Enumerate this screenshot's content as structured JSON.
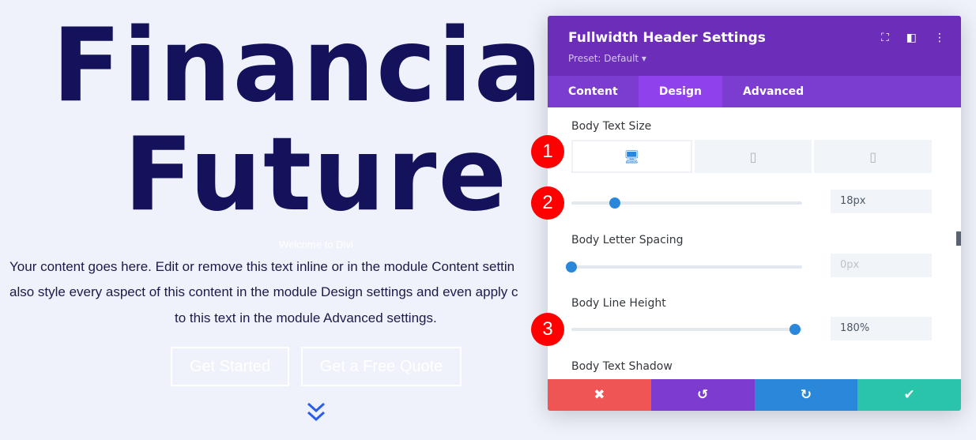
{
  "hero": {
    "title_line1": "Financial",
    "title_line2": "Future",
    "subtitle": "Welcome to Divi",
    "body_lines": [
      "Your content goes here. Edit or remove this text inline or in the module Content settin",
      "also style every aspect of this content in the module Design settings and even apply c",
      "to this text in the module Advanced settings."
    ],
    "button1": "Get Started",
    "button2": "Get a Free Quote",
    "scroll_icon": "double-chevron-down"
  },
  "panel": {
    "title": "Fullwidth Header Settings",
    "preset": "Preset: Default ▾",
    "tabs": [
      "Content",
      "Design",
      "Advanced"
    ],
    "active_tab": "Design",
    "body_text_size": {
      "label": "Body Text Size",
      "value": "18px",
      "slider_percent": 19,
      "device": "desktop"
    },
    "body_letter_spacing": {
      "label": "Body Letter Spacing",
      "value": "0px",
      "slider_percent": 0
    },
    "body_line_height": {
      "label": "Body Line Height",
      "value": "180%",
      "slider_percent": 97
    },
    "body_text_shadow": {
      "label": "Body Text Shadow"
    },
    "footer": {
      "cancel": "✖",
      "undo": "↺",
      "redo": "↻",
      "save": "✔"
    }
  },
  "badges": [
    "1",
    "2",
    "3"
  ],
  "colors": {
    "header": "#6c2eb9",
    "tabs": "#7b3dd0",
    "active_tab": "#8f42ec",
    "cancel": "#ef5555",
    "undo": "#7e3bd0",
    "redo": "#2b87da",
    "save": "#29c4a9",
    "accent": "#2b87da"
  }
}
